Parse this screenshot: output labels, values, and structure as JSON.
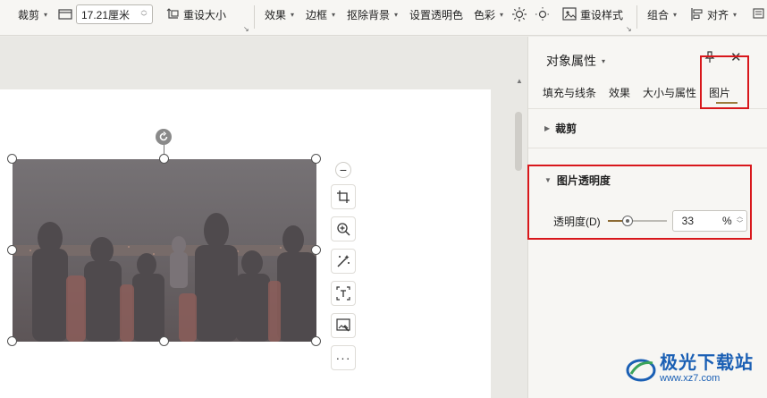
{
  "toolbar": {
    "crop_label": "裁剪",
    "size_value": "17.21厘米",
    "reset_size_label": "重设大小",
    "effects_label": "效果",
    "border_label": "边框",
    "remove_bg_label": "抠除背景",
    "set_transparent_label": "设置透明色",
    "color_label": "色彩",
    "reset_style_label": "重设样式",
    "group_label": "组合",
    "align_label": "对齐"
  },
  "panel": {
    "title": "对象属性",
    "tabs": [
      {
        "label": "填充与线条"
      },
      {
        "label": "效果"
      },
      {
        "label": "大小与属性"
      },
      {
        "label": "图片"
      }
    ],
    "sections": {
      "crop": "裁剪",
      "transparency": "图片透明度"
    },
    "transparency_label": "透明度(D)",
    "transparency_value": "33",
    "transparency_unit": "%",
    "transparency_level": 0.33
  },
  "watermark": {
    "name": "极光下载站",
    "url": "www.xz7.com"
  },
  "colors": {
    "accent": "#9c7b3c",
    "highlight": "#d8171b",
    "brand": "#1a5fb4"
  }
}
